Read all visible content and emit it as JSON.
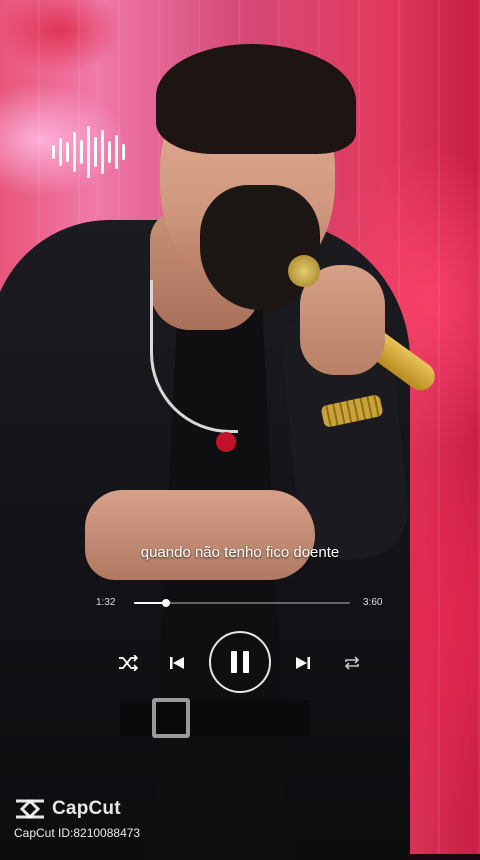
{
  "background": {
    "description_icon": "performer-photo",
    "accent_colors": [
      "#e8557a",
      "#c81e44",
      "#f07aa8"
    ]
  },
  "waveform": {
    "icon": "audio-waveform-icon"
  },
  "lyrics": {
    "current_line": "quando não tenho fico doente"
  },
  "player": {
    "current_time": "1:32",
    "total_time": "3:60",
    "progress": 0.15,
    "controls": {
      "shuffle_icon": "shuffle-icon",
      "previous_icon": "skip-previous-icon",
      "play_pause_icon": "pause-icon",
      "next_icon": "skip-next-icon",
      "repeat_icon": "repeat-icon"
    }
  },
  "watermark": {
    "brand": "CapCut",
    "id_line": "CapCut ID:8210088473"
  }
}
